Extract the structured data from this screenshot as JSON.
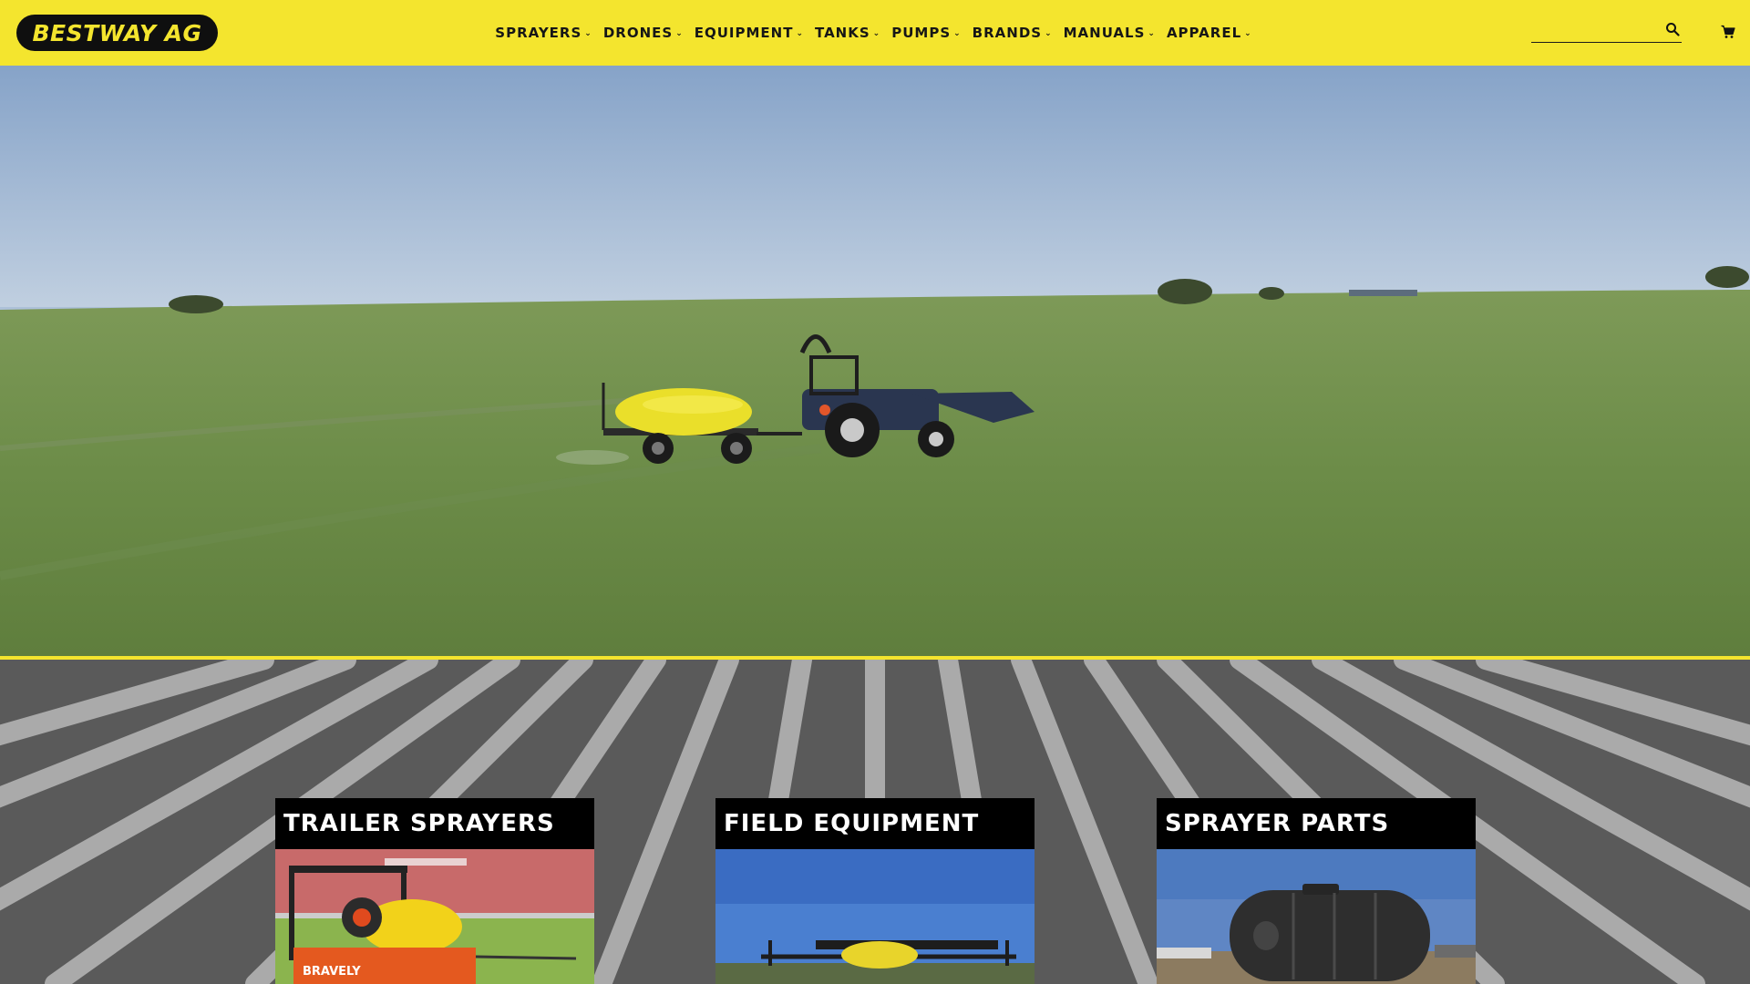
{
  "brand": {
    "logo_text": "BESTWAY AG",
    "accent_color": "#f4e52e"
  },
  "nav": {
    "items": [
      {
        "label": "SPRAYERS"
      },
      {
        "label": "DRONES"
      },
      {
        "label": "EQUIPMENT"
      },
      {
        "label": "TANKS"
      },
      {
        "label": "PUMPS"
      },
      {
        "label": "BRANDS"
      },
      {
        "label": "MANUALS"
      },
      {
        "label": "APPAREL"
      }
    ],
    "dropdown_icon": "chevron-down-icon"
  },
  "search": {
    "value": "",
    "placeholder": "",
    "icon": "search-icon"
  },
  "cart": {
    "icon": "shopping-cart-icon"
  },
  "hero": {
    "image": "tractor pulling a yellow trailer sprayer across a green field"
  },
  "categories": [
    {
      "title": "TRAILER SPRAYERS",
      "image": "orange utility vehicle with yellow sprayer tank"
    },
    {
      "title": "FIELD EQUIPMENT",
      "image": "sprayer boom with yellow tank under blue sky"
    },
    {
      "title": "SPRAYER PARTS",
      "image": "black poly storage tank on a trailer"
    }
  ]
}
